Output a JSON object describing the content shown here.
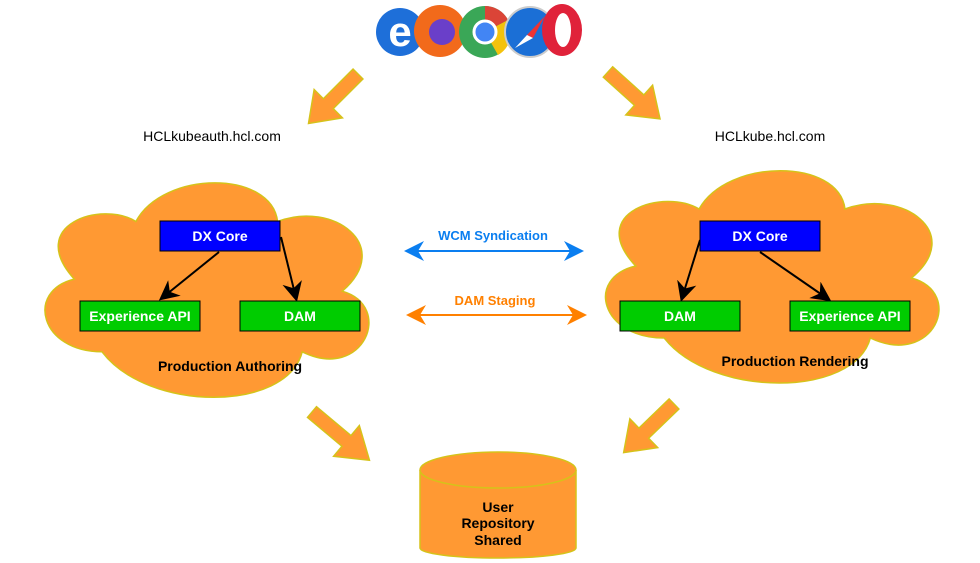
{
  "browsers": {
    "icons": [
      "internet-explorer-icon",
      "firefox-icon",
      "chrome-icon",
      "safari-icon",
      "opera-icon"
    ],
    "colors": [
      "#1e6fd9",
      "#f26a1b",
      "#3aa757",
      "#1b6fd6",
      "#e0223a"
    ]
  },
  "hosts": {
    "authoring": "HCLkubeauth.hcl.com",
    "rendering": "HCLkube.hcl.com"
  },
  "authoring": {
    "label": "Production Authoring",
    "core": "DX Core",
    "api": "Experience API",
    "dam": "DAM"
  },
  "rendering": {
    "label": "Production Rendering",
    "core": "DX Core",
    "dam": "DAM",
    "api": "Experience API"
  },
  "links": {
    "wcm": {
      "label": "WCM Syndication",
      "color": "#0a7ef0"
    },
    "dam": {
      "label": "DAM Staging",
      "color": "#ff8000"
    }
  },
  "repository": {
    "line1": "User",
    "line2": "Repository",
    "line3": "Shared"
  },
  "colors": {
    "cloud": "#ff9933",
    "cloud_stroke": "#d6c21a",
    "core": "#0000ff",
    "service": "#00cc00"
  }
}
